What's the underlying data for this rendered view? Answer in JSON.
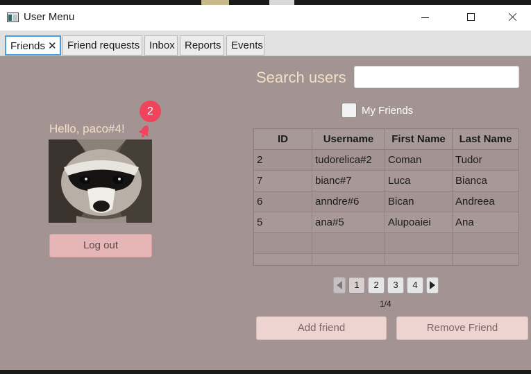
{
  "window": {
    "title": "User Menu",
    "app_icon": "app-window-icon",
    "controls": [
      "minimize-icon",
      "maximize-icon",
      "close-icon"
    ]
  },
  "tabs": [
    {
      "label": "Friends",
      "active": true,
      "closable": true,
      "close_glyph": "✕"
    },
    {
      "label": "Friend requests",
      "active": false
    },
    {
      "label": "Inbox",
      "active": false
    },
    {
      "label": "Reports",
      "active": false
    },
    {
      "label": "Events",
      "active": false
    }
  ],
  "profile": {
    "greeting": "Hello, paco#4!",
    "notification_count": "2",
    "notification_icon": "bell-icon",
    "avatar": "raccoon-avatar",
    "logout_label": "Log out"
  },
  "search": {
    "label": "Search users",
    "value": "",
    "placeholder": ""
  },
  "filter": {
    "my_friends_label": "My Friends",
    "my_friends_checked": false
  },
  "table": {
    "columns": [
      "ID",
      "Username",
      "First Name",
      "Last Name"
    ],
    "rows": [
      [
        "2",
        "tudorelica#2",
        "Coman",
        "Tudor"
      ],
      [
        "7",
        "bianc#7",
        "Luca",
        "Bianca"
      ],
      [
        "6",
        "anndre#6",
        "Bican",
        "Andreea"
      ],
      [
        "5",
        "ana#5",
        "Alupoaiei",
        "Ana"
      ]
    ]
  },
  "pagination": {
    "pages": [
      "1",
      "2",
      "3",
      "4"
    ],
    "current_page": "1",
    "info": "1/4",
    "prev_icon": "arrow-left-icon",
    "next_icon": "arrow-right-icon"
  },
  "actions": {
    "add_label": "Add friend",
    "remove_label": "Remove Friend"
  },
  "colors": {
    "background": "#a39393",
    "accent_text": "#f3dfc5",
    "badge": "#f0435c",
    "logout_button": "#e6b5b5",
    "action_button": "#edd4d0",
    "active_tab_border": "#4a9be0"
  }
}
